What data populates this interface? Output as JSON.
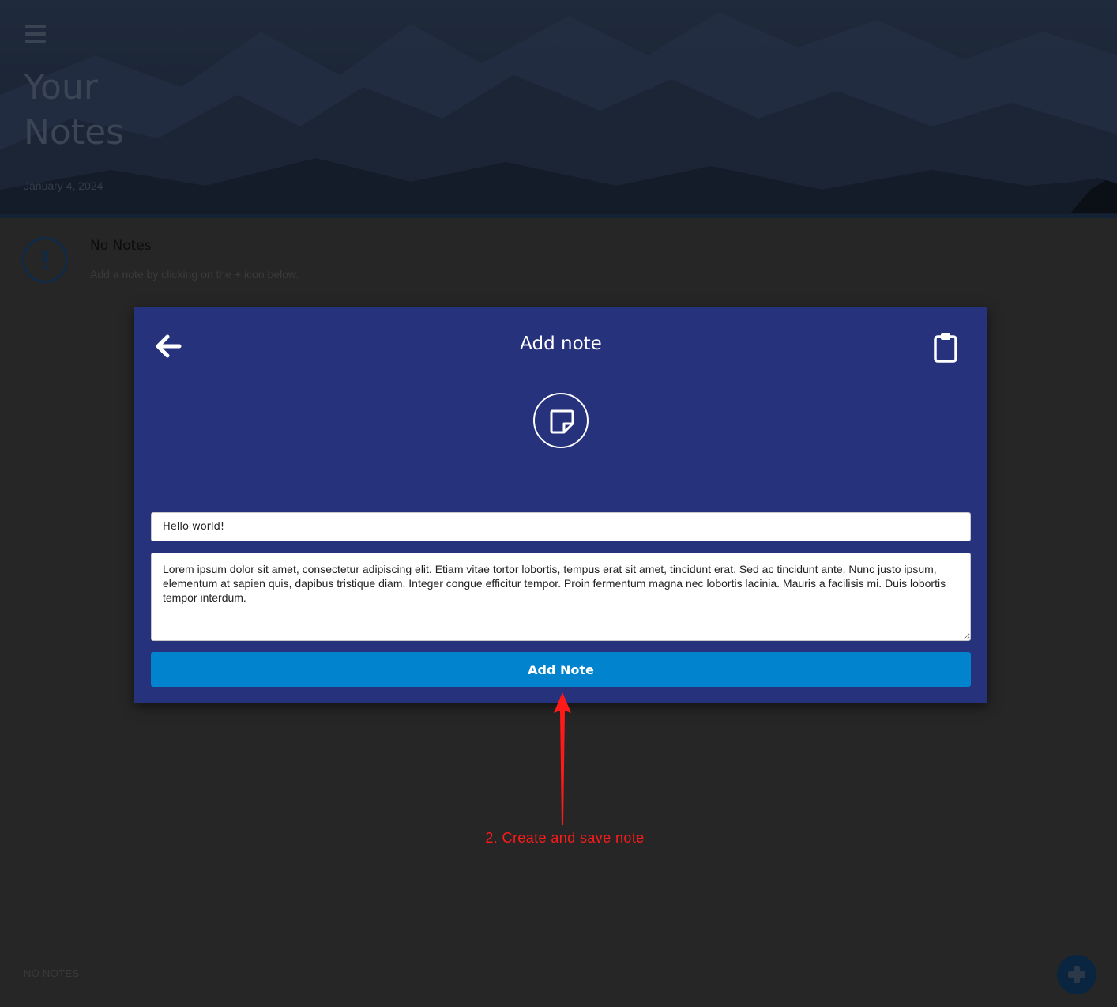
{
  "header": {
    "title": "Your Notes",
    "date": "January 4, 2024"
  },
  "empty_state": {
    "title": "No Notes",
    "subtitle": "Add a note by clicking on the + icon below."
  },
  "footer": {
    "label": "NO NOTES"
  },
  "modal": {
    "title": "Add note",
    "title_input_value": "Hello world!",
    "body_input_value": "Lorem ipsum dolor sit amet, consectetur adipiscing elit. Etiam vitae tortor lobortis, tempus erat sit amet, tincidunt erat. Sed ac tincidunt ante. Nunc justo ipsum, elementum at sapien quis, dapibus tristique diam. Integer congue efficitur tempor. Proin fermentum magna nec lobortis lacinia. Mauris a facilisis mi. Duis lobortis tempor interdum.",
    "submit_label": "Add Note"
  },
  "annotation": {
    "text": "2. Create and save note",
    "color": "#ff1a1a"
  },
  "colors": {
    "modal_bg": "#27327c",
    "button_bg": "#0283cd",
    "page_bg": "#262626"
  },
  "icons": {
    "menu": "hamburger-menu-icon",
    "alert": "exclamation-circle-icon",
    "back": "arrow-left-icon",
    "clipboard": "clipboard-icon",
    "note": "sticky-note-icon",
    "add": "plus-circle-icon"
  }
}
